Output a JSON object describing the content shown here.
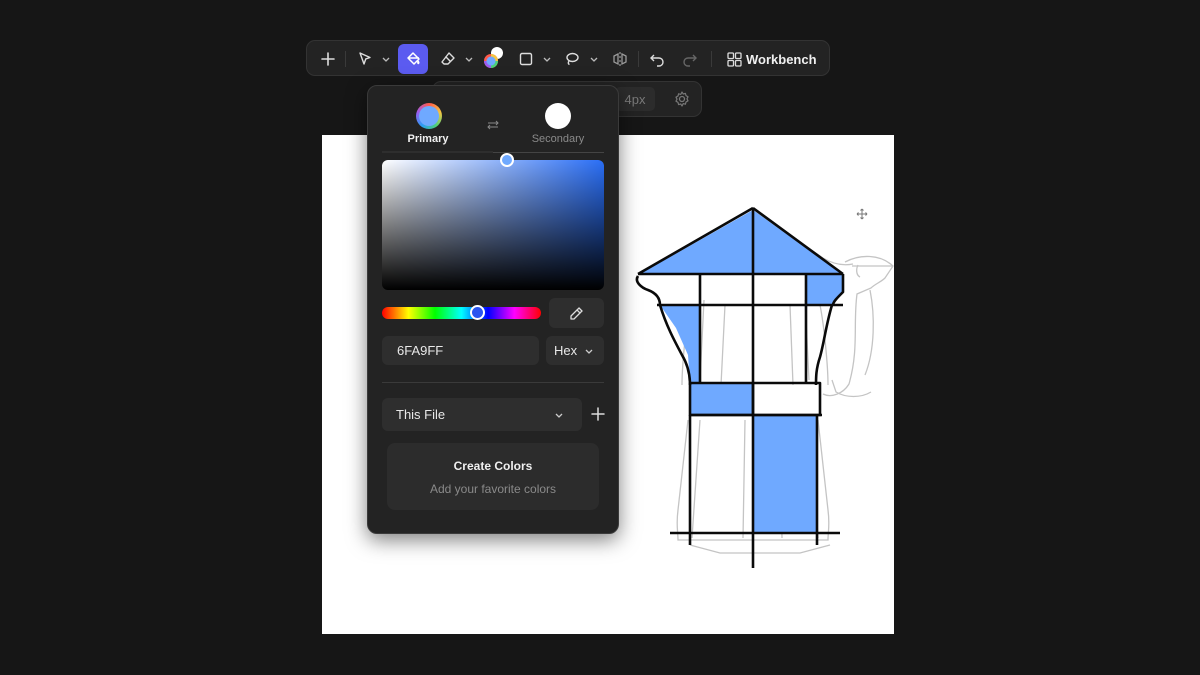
{
  "toolbar": {
    "tools": [
      "add-tool",
      "select-tool",
      "fill-tool",
      "eraser-tool",
      "color-tool",
      "shape-tool",
      "lasso-tool",
      "mirror-tool",
      "undo",
      "redo"
    ],
    "workbench_label": "Workbench"
  },
  "brush_bar": {
    "size_value": "4px"
  },
  "color_panel": {
    "primary_label": "Primary",
    "secondary_label": "Secondary",
    "primary_color": "#6FA9FF",
    "secondary_color": "#FFFFFF",
    "hex_value": "6FA9FF",
    "format_label": "Hex",
    "palette_source": "This File",
    "empty_title": "Create Colors",
    "empty_subtitle": "Add your favorite colors"
  },
  "colors": {
    "accent": "#5B5BF0",
    "fill_blue": "#6FA9FF",
    "background": "#161616",
    "panel": "#232323"
  }
}
